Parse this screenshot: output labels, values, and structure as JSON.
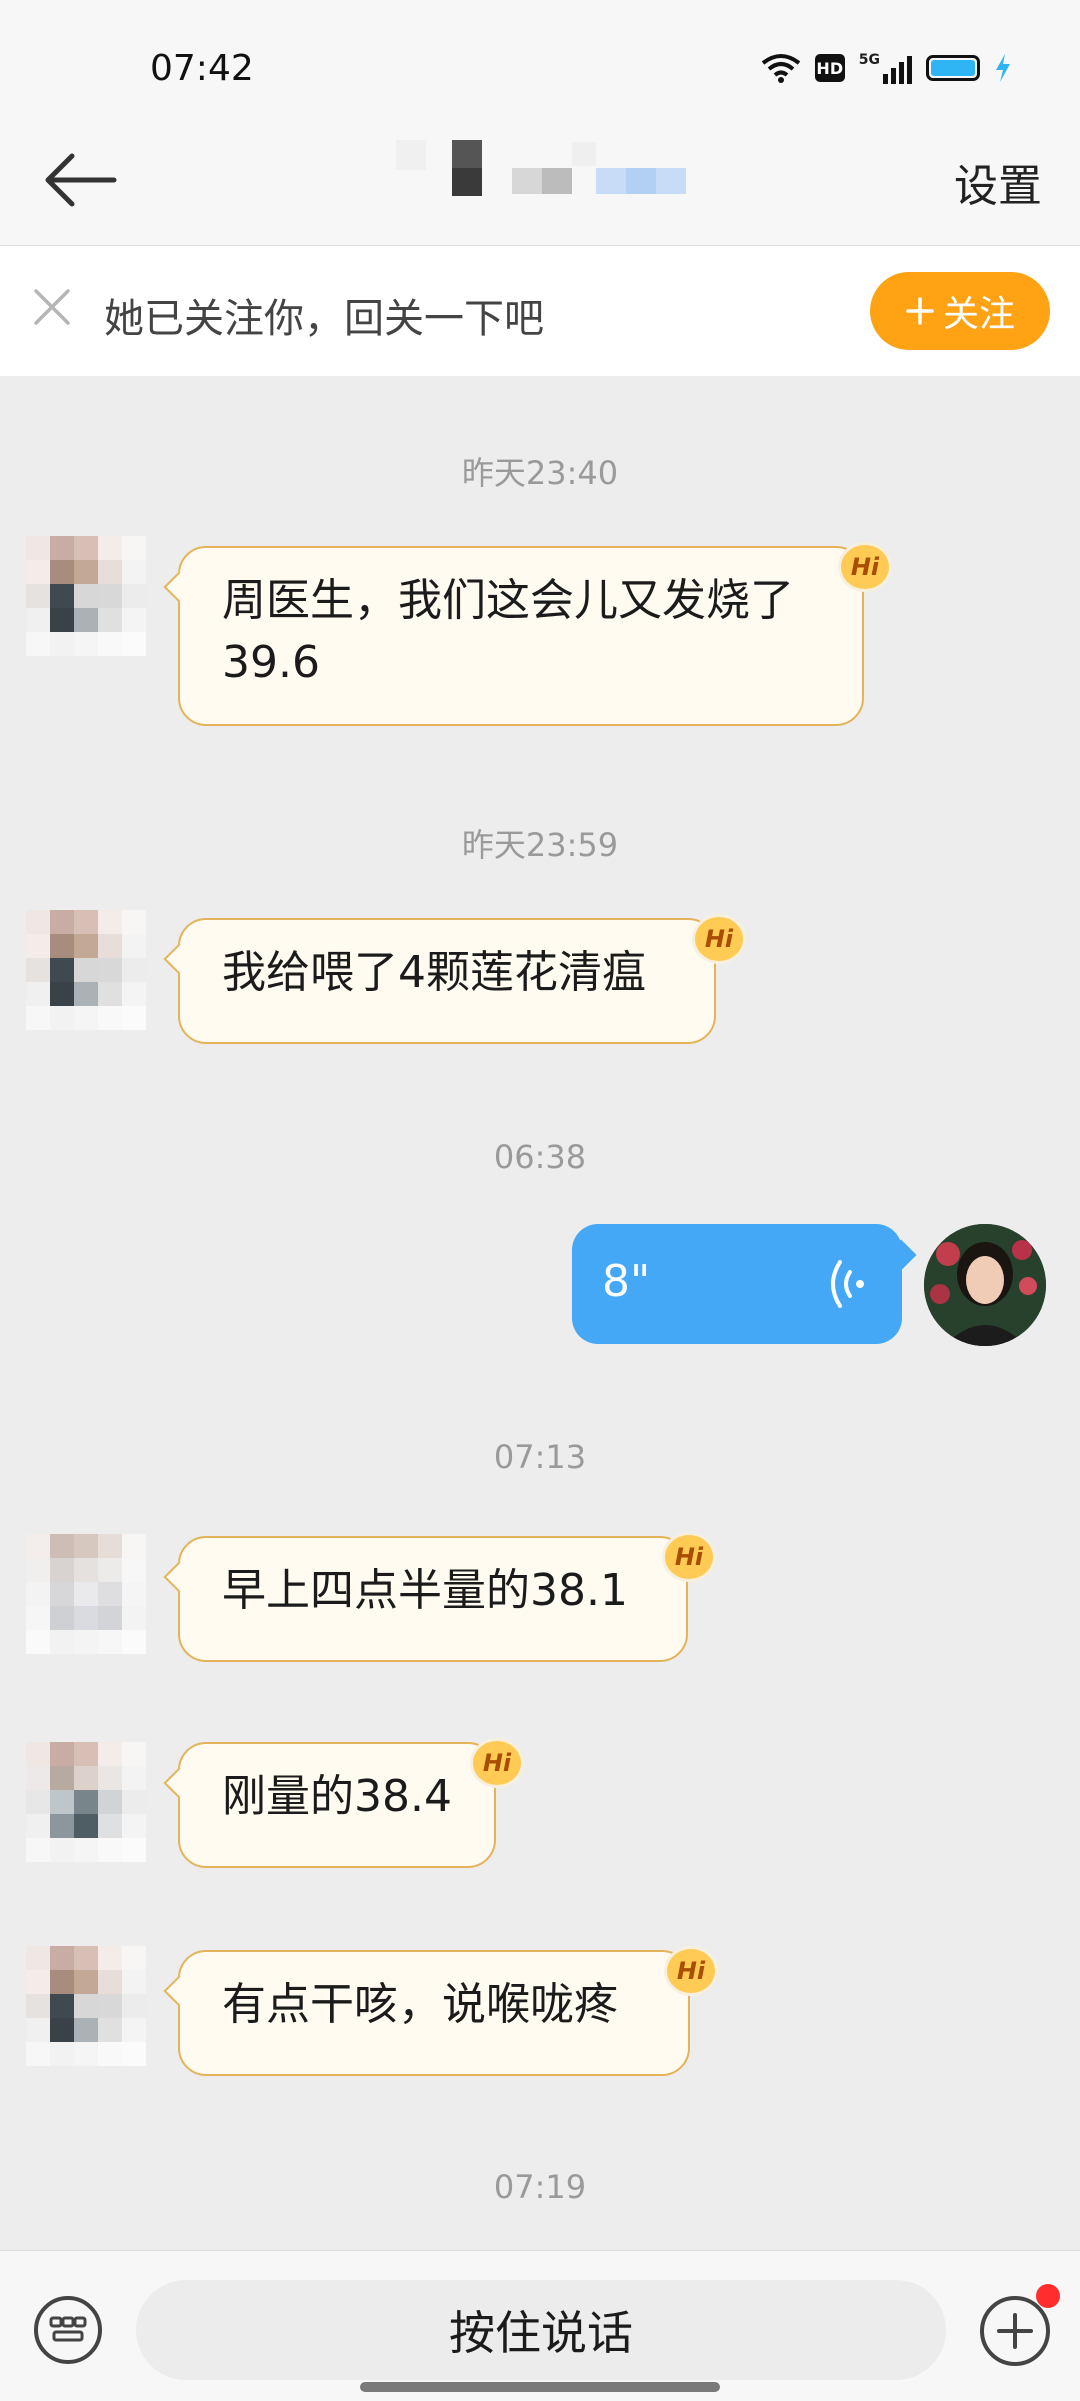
{
  "status_bar": {
    "time": "07:42",
    "icons": [
      "wifi-icon",
      "hd-icon",
      "signal-5g-icon",
      "battery-icon",
      "charging-icon"
    ],
    "hd_label": "HD",
    "net_label": "5G"
  },
  "header": {
    "back_icon": "arrow-left-icon",
    "title": "",
    "settings_label": "设置"
  },
  "follow_bar": {
    "close_icon": "close-icon",
    "text": "她已关注你，回关一下吧",
    "follow_button": "关注",
    "follow_icon": "plus-icon",
    "accent": "#ffa214"
  },
  "messages": [
    {
      "timestamp": "昨天23:40",
      "text": "周医生，我们这会儿又发烧了39.6",
      "badge": "Hi"
    },
    {
      "timestamp": "昨天23:59",
      "text": "我给喂了4颗莲花清瘟",
      "badge": "Hi"
    },
    {
      "timestamp": "06:38",
      "voice_duration": "8\"",
      "voice_icon": "voice-wave-icon"
    },
    {
      "timestamp": "07:13",
      "text": "早上四点半量的38.1",
      "badge": "Hi"
    },
    {
      "text": "刚量的38.4",
      "badge": "Hi"
    },
    {
      "text": "有点干咳，说喉咙疼",
      "badge": "Hi"
    },
    {
      "timestamp": "07:19"
    }
  ],
  "bottom_bar": {
    "keyboard_icon": "keyboard-icon",
    "talk_button": "按住说话",
    "plus_icon": "plus-circle-icon"
  },
  "colors": {
    "incoming_bubble_bg": "#fffbf1",
    "incoming_bubble_border": "#e4b35a",
    "outgoing_bubble_bg": "#45a8f6",
    "badge_bg": "#ffcb55"
  }
}
